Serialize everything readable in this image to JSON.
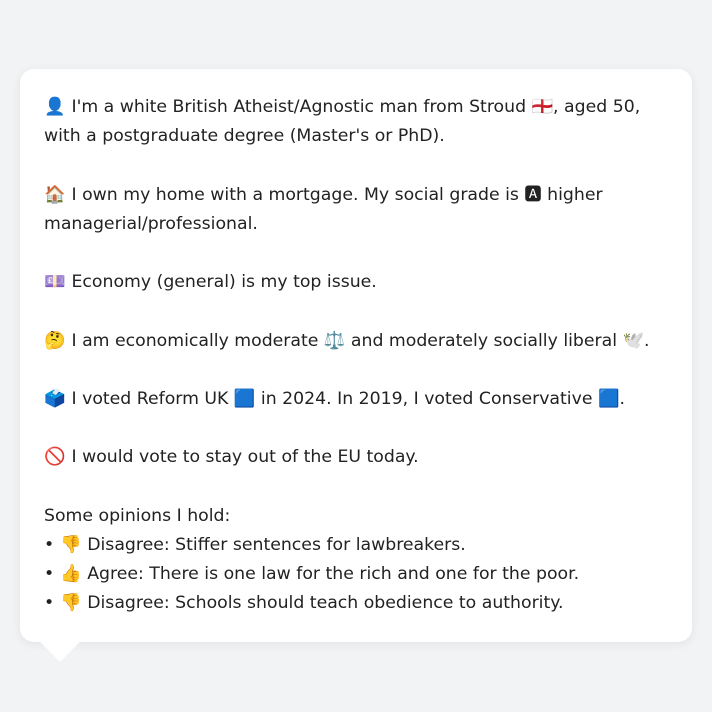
{
  "profile": {
    "intro": {
      "emoji": "👤",
      "text": "I'm a white British Atheist/Agnostic man from Stroud 🏴󠁧󠁢󠁥󠁮󠁧󠁿, aged 50, with a postgraduate degree (Master's or PhD)."
    },
    "home": {
      "emoji": "🏠",
      "text": "I own my home with a mortgage. My social grade is 🅰 higher managerial/professional."
    },
    "issue": {
      "emoji": "💷",
      "text": "Economy (general) is my top issue."
    },
    "views": {
      "emoji": "🤔",
      "text": "I am economically moderate ⚖️ and moderately socially liberal 🕊️."
    },
    "vote": {
      "emoji": "🗳️",
      "text": "I voted Reform UK 🟦 in 2024. In 2019, I voted Conservative 🟦."
    },
    "eu": {
      "emoji": "🚫",
      "text": "I would vote to stay out of the EU today."
    }
  },
  "opinions": {
    "heading": "Some opinions I hold:",
    "items": [
      {
        "bullet": "•",
        "emoji": "👎",
        "text": "Disagree: Stiffer sentences for lawbreakers."
      },
      {
        "bullet": "•",
        "emoji": "👍",
        "text": "Agree: There is one law for the rich and one for the poor."
      },
      {
        "bullet": "•",
        "emoji": "👎",
        "text": "Disagree: Schools should teach obedience to authority."
      }
    ]
  }
}
